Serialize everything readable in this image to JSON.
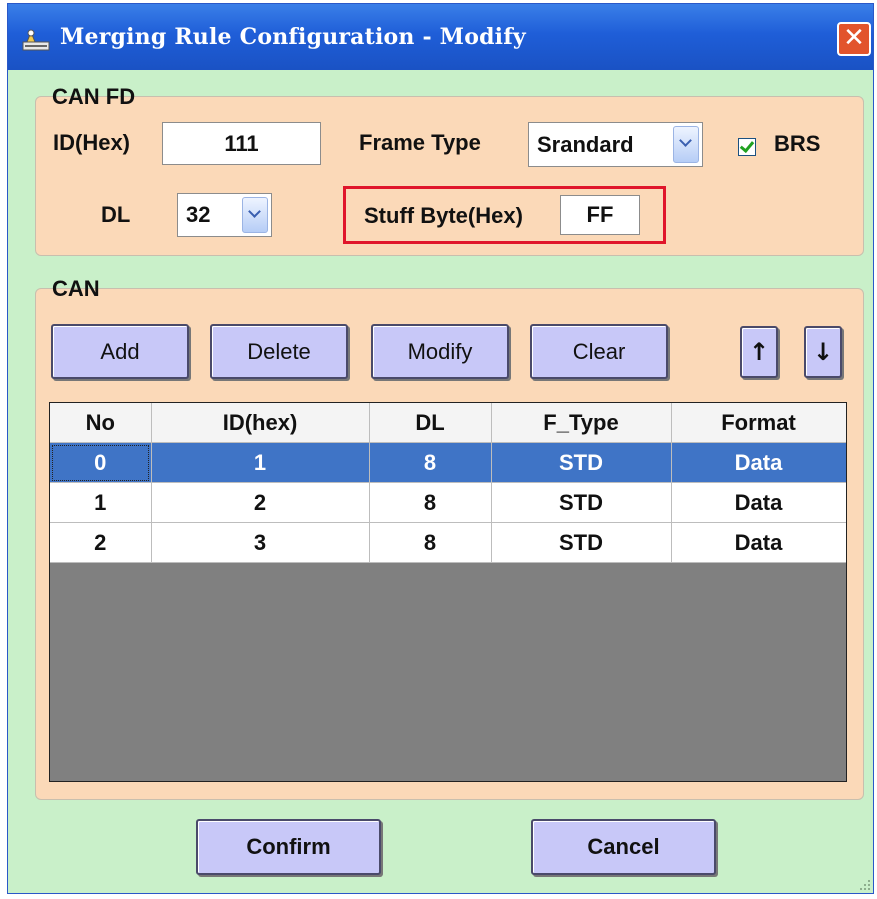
{
  "window": {
    "title": "Merging Rule Configuration - Modify",
    "close_label": "✕"
  },
  "canfd": {
    "group_title": "CAN FD",
    "id_label": "ID(Hex)",
    "id_value": "111",
    "frame_type_label": "Frame Type",
    "frame_type_value": "Srandard",
    "brs_label": "BRS",
    "brs_checked": true,
    "dl_label": "DL",
    "dl_value": "32",
    "stuff_byte_label": "Stuff Byte(Hex)",
    "stuff_byte_value": "FF",
    "highlight_color": "#e0162b"
  },
  "can": {
    "group_title": "CAN",
    "buttons": {
      "add": "Add",
      "delete": "Delete",
      "modify": "Modify",
      "clear": "Clear",
      "up": "↑",
      "down": "↓"
    },
    "table": {
      "headers": [
        "No",
        "ID(hex)",
        "DL",
        "F_Type",
        "Format"
      ],
      "rows": [
        [
          "0",
          "1",
          "8",
          "STD",
          "Data"
        ],
        [
          "1",
          "2",
          "8",
          "STD",
          "Data"
        ],
        [
          "2",
          "3",
          "8",
          "STD",
          "Data"
        ]
      ],
      "selected_row": 0
    }
  },
  "footer": {
    "confirm": "Confirm",
    "cancel": "Cancel"
  },
  "colors": {
    "window_bg": "#c9f0c9",
    "group_bg": "#fbd9b8",
    "button_bg": "#c8c8f8",
    "selection": "#3f74c6",
    "titlebar": "#1f5ed8"
  }
}
